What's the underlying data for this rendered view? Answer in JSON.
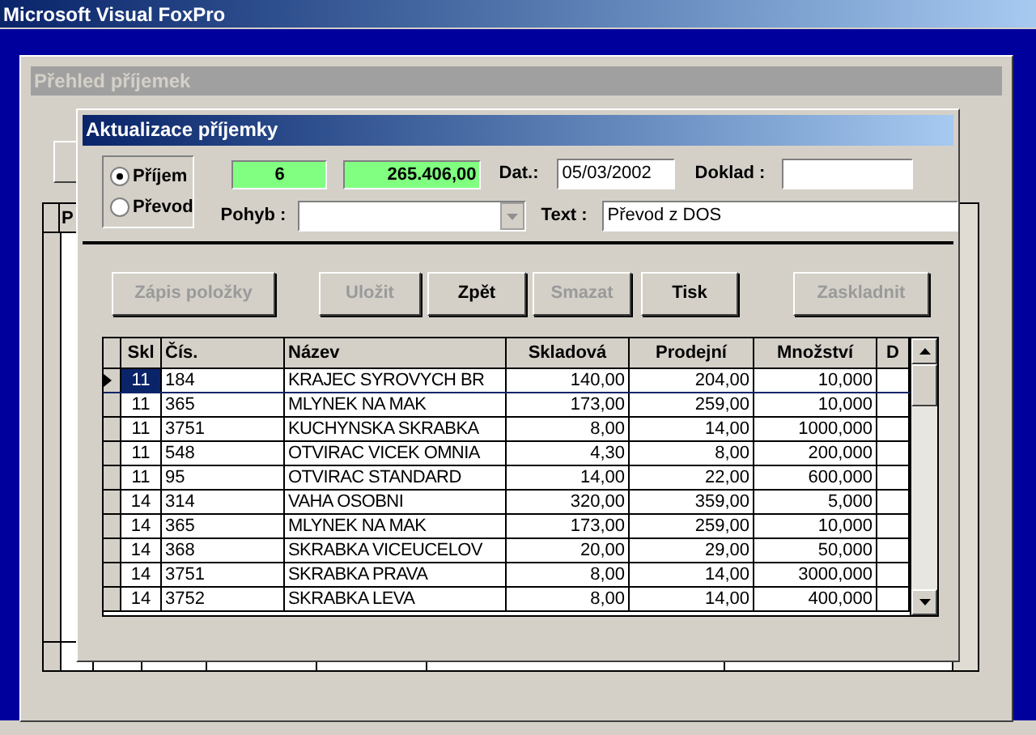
{
  "app_title": "Microsoft Visual FoxPro",
  "background_window": {
    "title": "Přehled příjemek",
    "grid_header": "P"
  },
  "dialog": {
    "title": "Aktualizace příjemky",
    "type_options": [
      {
        "label": "Příjem",
        "selected": true
      },
      {
        "label": "Převod",
        "selected": false
      }
    ],
    "count": "6",
    "total": "265.406,00",
    "date_label": "Dat.:",
    "date": "05/03/2002",
    "document_label": "Doklad :",
    "movement_label": "Pohyb :",
    "text_label": "Text :",
    "text": "Převod z DOS",
    "buttons": [
      {
        "label": "Zápis položky",
        "disabled": true
      },
      {
        "label": "Uložit",
        "disabled": true
      },
      {
        "label": "Zpět",
        "disabled": false
      },
      {
        "label": "Smazat",
        "disabled": true
      },
      {
        "label": "Tisk",
        "disabled": false
      },
      {
        "label": "Zaskladnit",
        "disabled": true
      }
    ],
    "table": {
      "columns": [
        "Skl",
        "Čís.",
        "Název",
        "Skladová",
        "Prodejní",
        "Množství",
        "D"
      ],
      "rows": [
        {
          "selected": true,
          "cells": [
            "11",
            "184",
            "KRAJEC SYROVYCH BR",
            "140,00",
            "204,00",
            "10,000",
            ""
          ]
        },
        {
          "selected": false,
          "cells": [
            "11",
            "365",
            "MLYNEK NA MAK",
            "173,00",
            "259,00",
            "10,000",
            ""
          ]
        },
        {
          "selected": false,
          "cells": [
            "11",
            "3751",
            "KUCHYNSKA SKRABKA",
            "8,00",
            "14,00",
            "1000,000",
            ""
          ]
        },
        {
          "selected": false,
          "cells": [
            "11",
            "548",
            "OTVIRAC VICEK OMNIA",
            "4,30",
            "8,00",
            "200,000",
            ""
          ]
        },
        {
          "selected": false,
          "cells": [
            "11",
            "95",
            "OTVIRAC STANDARD",
            "14,00",
            "22,00",
            "600,000",
            ""
          ]
        },
        {
          "selected": false,
          "cells": [
            "14",
            "314",
            "VAHA OSOBNI",
            "320,00",
            "359,00",
            "5,000",
            ""
          ]
        },
        {
          "selected": false,
          "cells": [
            "14",
            "365",
            "MLYNEK NA MAK",
            "173,00",
            "259,00",
            "10,000",
            ""
          ]
        },
        {
          "selected": false,
          "cells": [
            "14",
            "368",
            "SKRABKA VICEUCELOV",
            "20,00",
            "29,00",
            "50,000",
            ""
          ]
        },
        {
          "selected": false,
          "cells": [
            "14",
            "3751",
            "SKRABKA PRAVA",
            "8,00",
            "14,00",
            "3000,000",
            ""
          ]
        },
        {
          "selected": false,
          "cells": [
            "14",
            "3752",
            "SKRABKA LEVA",
            "8,00",
            "14,00",
            "400,000",
            ""
          ]
        }
      ]
    }
  }
}
